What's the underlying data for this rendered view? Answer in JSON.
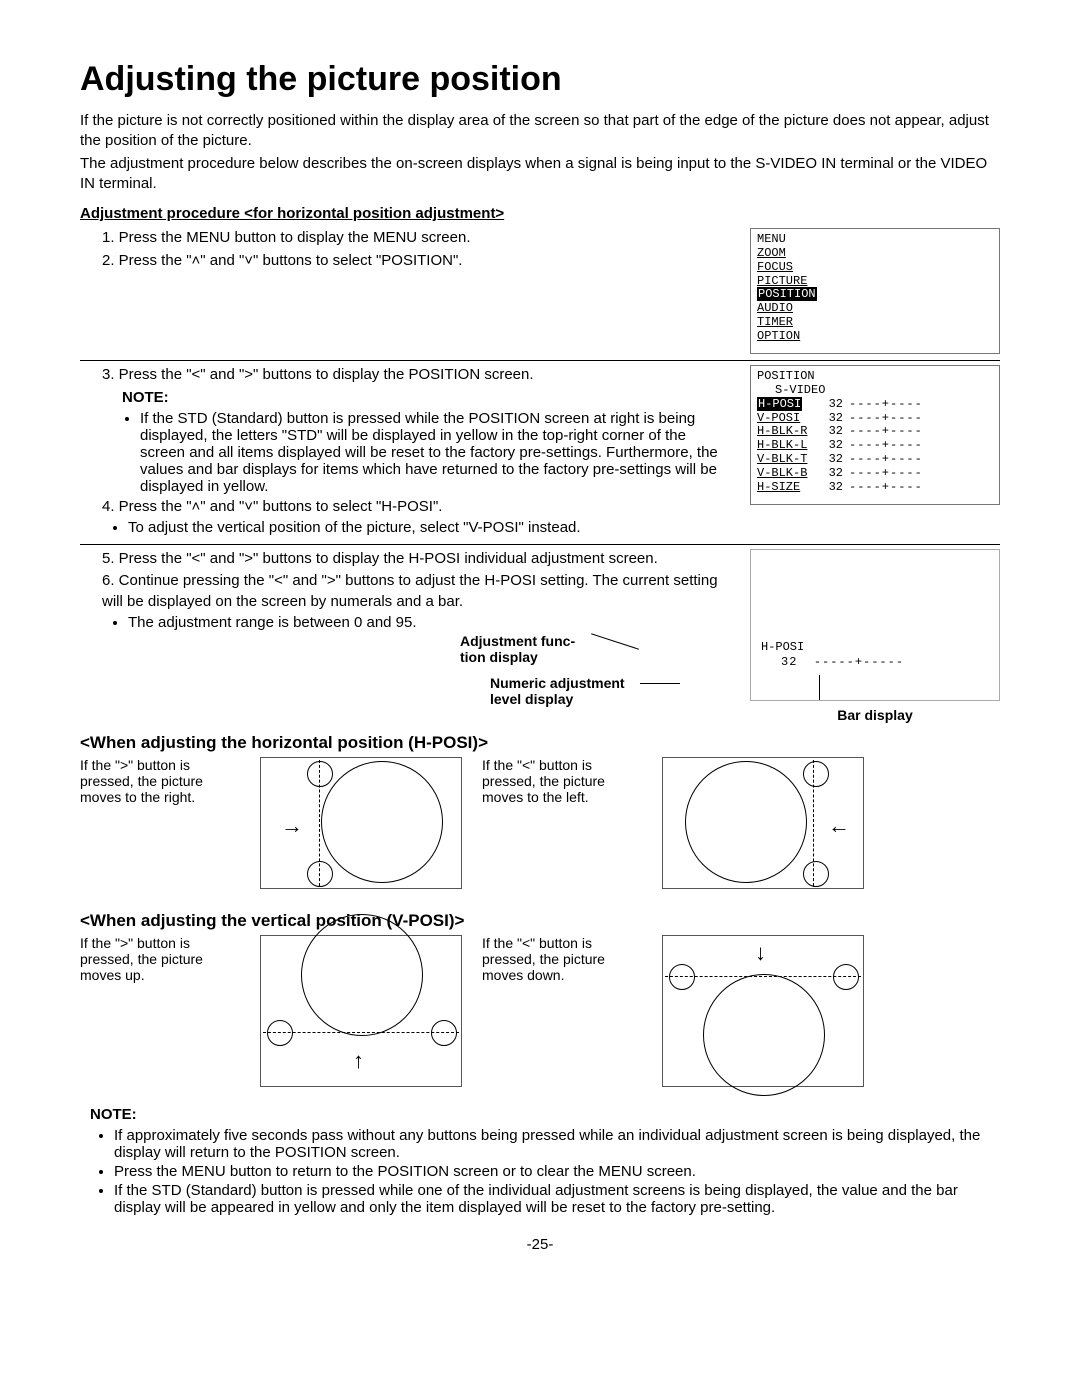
{
  "title": "Adjusting the picture position",
  "intro1": "If the picture is not correctly positioned within the display area of the screen so that part of the edge of the picture does not appear, adjust the position of the picture.",
  "intro2": "The adjustment procedure below describes the on-screen displays when a signal is being input to the S-VIDEO IN terminal or the VIDEO IN terminal.",
  "procHeading": "Adjustment procedure <for horizontal position adjustment>",
  "step1": "1. Press the MENU button to display the MENU screen.",
  "step2": "2. Press the \"˄\" and \"˅\" buttons to select \"POSITION\".",
  "menu": {
    "title": "MENU",
    "items": [
      "ZOOM",
      "FOCUS",
      "PICTURE",
      "POSITION",
      "AUDIO",
      "TIMER",
      "OPTION"
    ],
    "selected": "POSITION"
  },
  "step3": "3. Press the \"<\" and \">\" buttons to display the POSITION screen.",
  "note_label": "NOTE:",
  "note3": "If the STD (Standard) button is pressed while the POSITION screen at right is being displayed, the letters \"STD\" will be displayed in yellow in the top-right corner of the screen and all items displayed will be reset to the factory pre-settings. Furthermore, the values and bar displays for items which have returned to the factory pre-settings will be displayed in yellow.",
  "position": {
    "title": "POSITION",
    "sub": "S-VIDEO",
    "rows": [
      {
        "name": "H-POSI",
        "val": "32",
        "hi": true
      },
      {
        "name": "V-POSI",
        "val": "32"
      },
      {
        "name": "H-BLK-R",
        "val": "32"
      },
      {
        "name": "H-BLK-L",
        "val": "32"
      },
      {
        "name": "V-BLK-T",
        "val": "32"
      },
      {
        "name": "V-BLK-B",
        "val": "32"
      },
      {
        "name": "H-SIZE",
        "val": "32"
      }
    ],
    "bar": "----+----"
  },
  "step4": "4. Press the \"˄\" and \"˅\" buttons to select \"H-POSI\".",
  "step4b": "To adjust the vertical position of the picture, select \"V-POSI\" instead.",
  "step5": "5. Press the \"<\" and \">\" buttons to display the H-POSI individual adjustment screen.",
  "step6": "6. Continue pressing the \"<\" and \">\" buttons to adjust the H-POSI setting. The current setting will be displayed on the screen by numerals and a bar.",
  "step6b": "The adjustment range is between 0 and 95.",
  "callout1a": "Adjustment func-",
  "callout1b": "tion display",
  "callout2a": "Numeric adjustment",
  "callout2b": "level display",
  "callout3": "Bar display",
  "adj": {
    "name": "H-POSI",
    "val": "32",
    "bar": "-----+-----"
  },
  "hHead": "<When adjusting the horizontal position (H-POSI)>",
  "hRight": "If the \">\" button is pressed, the picture moves to the right.",
  "hLeft": "If the \"<\" button is pressed, the picture moves to the left.",
  "vHead": "<When adjusting the vertical position (V-POSI)>",
  "vUp": "If the \">\" button is pressed, the picture moves up.",
  "vDown": "If the \"<\" button is pressed, the picture moves down.",
  "noteA": "If approximately five seconds pass without any buttons being pressed while an individual adjustment screen is being displayed, the display will return to the POSITION screen.",
  "noteB": "Press the MENU button to return to the POSITION screen or to clear the MENU screen.",
  "noteC": "If the STD (Standard) button is pressed while one of the individual adjustment screens is being displayed, the value and the bar display will be appeared in yellow and only the item displayed will be reset to the factory pre-setting.",
  "page": "-25-"
}
